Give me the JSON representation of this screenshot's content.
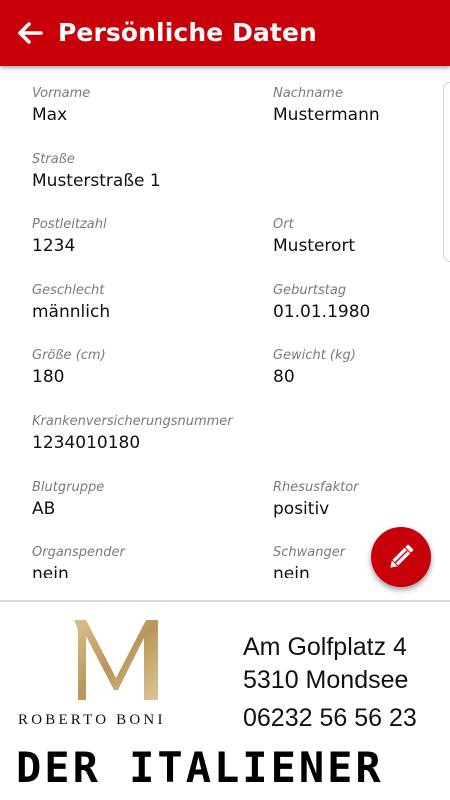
{
  "appbar": {
    "back_icon": "arrow-left-icon",
    "title": "Persönliche Daten",
    "color": "#c8000a"
  },
  "fields": {
    "vorname": {
      "label": "Vorname",
      "value": "Max"
    },
    "nachname": {
      "label": "Nachname",
      "value": "Mustermann"
    },
    "strasse": {
      "label": "Straße",
      "value": "Musterstraße 1"
    },
    "plz": {
      "label": "Postleitzahl",
      "value": "1234"
    },
    "ort": {
      "label": "Ort",
      "value": "Musterort"
    },
    "geschlecht": {
      "label": "Geschlecht",
      "value": "männlich"
    },
    "geburtstag": {
      "label": "Geburtstag",
      "value": "01.01.1980"
    },
    "groesse": {
      "label": "Größe (cm)",
      "value": "180"
    },
    "gewicht": {
      "label": "Gewicht (kg)",
      "value": "80"
    },
    "kvnr": {
      "label": "Krankenversicherungsnummer",
      "value": "1234010180"
    },
    "blutgruppe": {
      "label": "Blutgruppe",
      "value": "AB"
    },
    "rhesus": {
      "label": "Rhesusfaktor",
      "value": "positiv"
    },
    "organspender": {
      "label": "Organspender",
      "value": "nein"
    },
    "schwanger": {
      "label": "Schwanger",
      "value": "nein"
    }
  },
  "fab": {
    "icon": "pencil-icon"
  },
  "ad": {
    "logo_letter": "M",
    "brand": "ROBERTO BONI",
    "address_line1": "Am Golfplatz 4",
    "address_line2": "5310 Mondsee",
    "phone": "06232 56 56 23",
    "slogan": "DER ITALIENER",
    "logo_color": "#c8a96e"
  }
}
